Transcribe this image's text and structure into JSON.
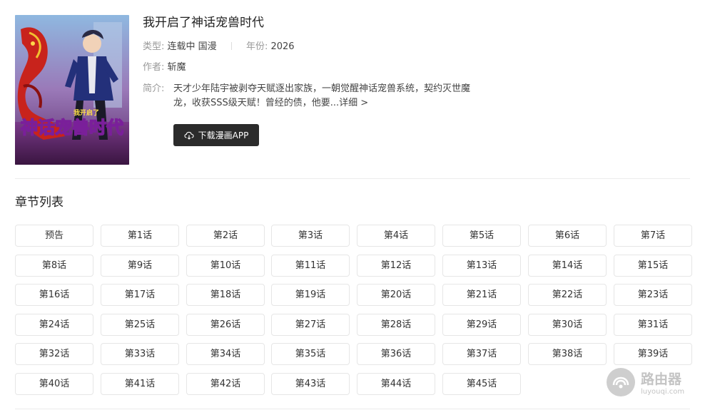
{
  "comic": {
    "title": "我开启了神话宠兽时代",
    "type_label": "类型:",
    "type_value": "连载中 国漫",
    "year_label": "年份:",
    "year_value": "2026",
    "author_label": "作者:",
    "author_value": "斩魔",
    "desc_label": "简介:",
    "desc_text": "天才少年陆宇被剥夺天赋逐出家族，一朝觉醒神话宠兽系统，契约灭世魔龙，收获SSS级天赋！曾经的债，他要...",
    "desc_more": "详细 >",
    "download_button": "下载漫画APP",
    "cover_logo_text": "神话宠兽时代",
    "cover_small_text": "我开启了"
  },
  "chapters": {
    "heading": "章节列表",
    "items": [
      "预告",
      "第1话",
      "第2话",
      "第3话",
      "第4话",
      "第5话",
      "第6话",
      "第7话",
      "第8话",
      "第9话",
      "第10话",
      "第11话",
      "第12话",
      "第13话",
      "第14话",
      "第15话",
      "第16话",
      "第17话",
      "第18话",
      "第19话",
      "第20话",
      "第21话",
      "第22话",
      "第23话",
      "第24话",
      "第25话",
      "第26话",
      "第27话",
      "第28话",
      "第29话",
      "第30话",
      "第31话",
      "第32话",
      "第33话",
      "第34话",
      "第35话",
      "第36话",
      "第37话",
      "第38话",
      "第39话",
      "第40话",
      "第41话",
      "第42话",
      "第43话",
      "第44话",
      "第45话"
    ]
  },
  "watermark": {
    "name": "路由器",
    "url": "luyouqi.com"
  },
  "colors": {
    "button_bg": "#2b2b2b",
    "border": "#e6e6e6",
    "label_gray": "#999999"
  }
}
